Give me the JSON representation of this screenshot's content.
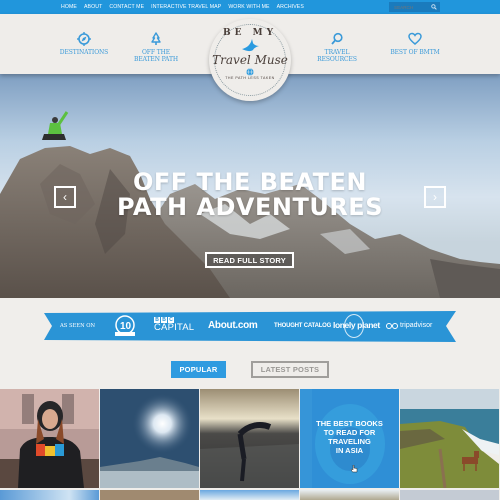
{
  "topnav": {
    "items": [
      "HOME",
      "ABOUT",
      "CONTACT ME",
      "INTERACTIVE TRAVEL MAP",
      "WORK WITH ME",
      "ARCHIVES"
    ],
    "search_placeholder": "SEARCH"
  },
  "header": {
    "categories": [
      {
        "label1": "DESTINATIONS",
        "label2": "",
        "icon": "compass-icon"
      },
      {
        "label1": "OFF THE",
        "label2": "BEATEN PATH",
        "icon": "tree-icon"
      },
      {
        "label1": "TRAVEL",
        "label2": "RESOURCES",
        "icon": "magnifier-icon"
      },
      {
        "label1": "BEST OF BMTM",
        "label2": "",
        "icon": "heart-icon"
      }
    ],
    "logo": {
      "top": "BE MY",
      "script": "Travel Muse",
      "tagline": "THE PATH LESS TAKEN"
    }
  },
  "hero": {
    "title_line1": "OFF THE BEATEN",
    "title_line2": "PATH ADVENTURES",
    "cta": "READ FULL STORY",
    "prev_icon": "‹",
    "next_icon": "›"
  },
  "press": {
    "label": "AS SEEN ON",
    "logos": {
      "bbc_letters": [
        "B",
        "B",
        "C"
      ],
      "bbc_capital": "CAPITAL",
      "about": "About.com",
      "thought_catalog": "THOUGHT CATALOG",
      "lonely_planet": "lonely planet",
      "tripadvisor": "tripadvisor"
    }
  },
  "tabs": {
    "popular": "POPULAR",
    "latest": "LATEST POSTS"
  },
  "posts": {
    "featured_title_lines": [
      "THE BEST BOOKS",
      "TO READ FOR",
      "TRAVELING",
      "IN ASIA"
    ]
  },
  "colors": {
    "brand_blue": "#2196dc",
    "paper": "#efedea",
    "logo_brown": "#4a3f3a"
  }
}
